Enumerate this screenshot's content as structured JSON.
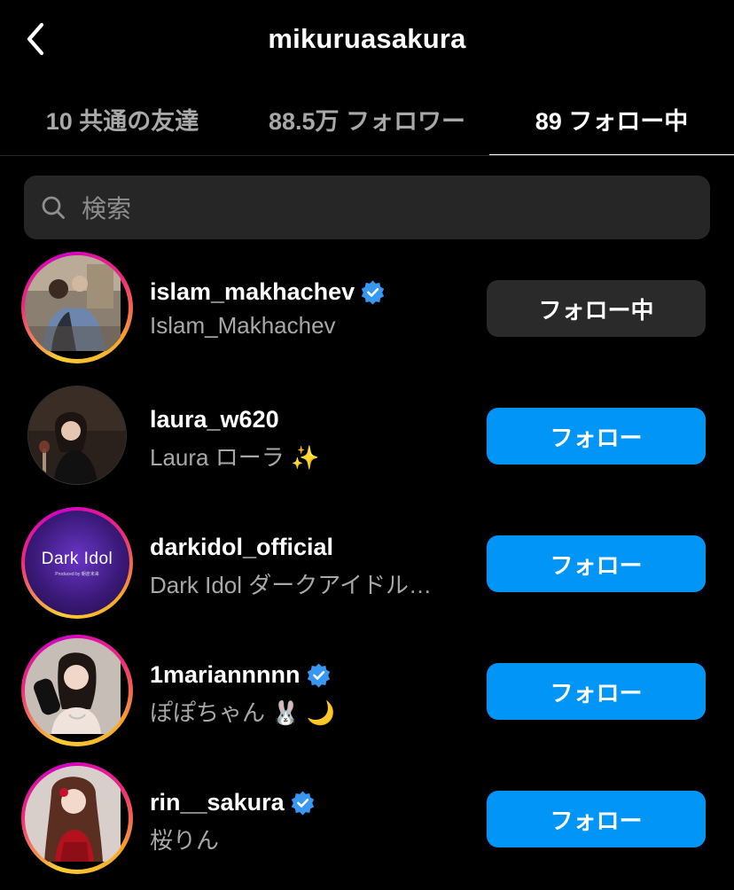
{
  "header": {
    "title": "mikuruasakura"
  },
  "tabs": [
    {
      "label": "10 共通の友達",
      "active": false
    },
    {
      "label": "88.5万 フォロワー",
      "active": false
    },
    {
      "label": "89 フォロー中",
      "active": true
    }
  ],
  "search": {
    "placeholder": "検索"
  },
  "users": [
    {
      "username": "islam_makhachev",
      "fullname": "Islam_Makhachev",
      "verified": true,
      "button": "フォロー中",
      "button_style": "following",
      "has_story": true
    },
    {
      "username": "laura_w620",
      "fullname": "Laura ローラ ✨",
      "verified": false,
      "button": "フォロー",
      "button_style": "follow",
      "has_story": false
    },
    {
      "username": "darkidol_official",
      "fullname": "Dark Idol ダークアイドル…",
      "verified": false,
      "button": "フォロー",
      "button_style": "follow",
      "has_story": true,
      "avatar_logo": "Dark Idol",
      "avatar_logo_sub": "Produced by 朝倉未来"
    },
    {
      "username": "1mariannnnn",
      "fullname": "ぽぽちゃん 🐰 🌙",
      "verified": true,
      "button": "フォロー",
      "button_style": "follow",
      "has_story": true
    },
    {
      "username": "rin__sakura",
      "fullname": "桜りん",
      "verified": true,
      "button": "フォロー",
      "button_style": "follow",
      "has_story": true
    }
  ],
  "colors": {
    "background": "#000000",
    "follow_blue": "#0095f6",
    "following_gray": "#2a2a2a",
    "verified_blue": "#3897f0",
    "secondary_text": "#a8a8a8"
  }
}
